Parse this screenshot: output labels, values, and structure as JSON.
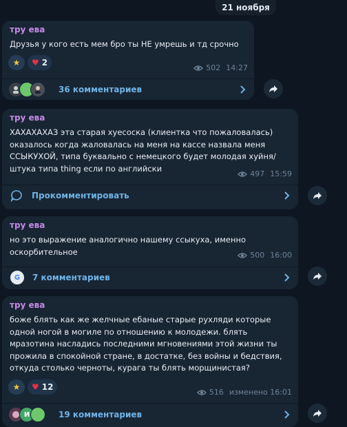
{
  "date_label": "21 ноября",
  "messages": [
    {
      "author": "тру ева",
      "text": "Друзья у кого есть мем бро ты НЕ умрешь и тд срочно",
      "views": "502",
      "time": "14:27",
      "reactions": {
        "star": "★",
        "heart_count": "2"
      },
      "comments_label": "36 комментариев"
    },
    {
      "author": "тру ева",
      "text": "ХАХАХАХАЗ эта старая хуесоска (клиентка что пожаловалась) оказалось когда жаловалась на меня на кассе назвала меня ССЫКУХОЙ, типа буквально с немецкого будет молодая хуйня/штука типа thing если по английски",
      "views": "497",
      "time": "15:59",
      "comments_label": "Прокомментировать"
    },
    {
      "author": "тру ева",
      "text": "но это выражение аналогично нашему ссыкуха, именно оскорбительное",
      "views": "500",
      "time": "16:00",
      "comments_label": "7 комментариев",
      "avatar_letter": "G"
    },
    {
      "author": "тру ева",
      "text": "боже блять как же желчные ебаные старые рухляди которые одной ногой в могиле по отношению к молодежи. блять мразотина насладись последними мгновениями этой жизни ты прожила в спокойной стране, в достатке, без войны и бедствия, откуда столько черноты, курага ты блять морщинистая?",
      "views": "516",
      "time": "изменено 16:01",
      "reactions": {
        "star": "★",
        "heart_count": "12"
      },
      "comments_label": "19 комментариев",
      "avatar_letter": "И"
    }
  ],
  "colors": {
    "background": "#0e1621",
    "bubble": "#182533",
    "author": "#c48be6",
    "link": "#6fb3e6"
  }
}
